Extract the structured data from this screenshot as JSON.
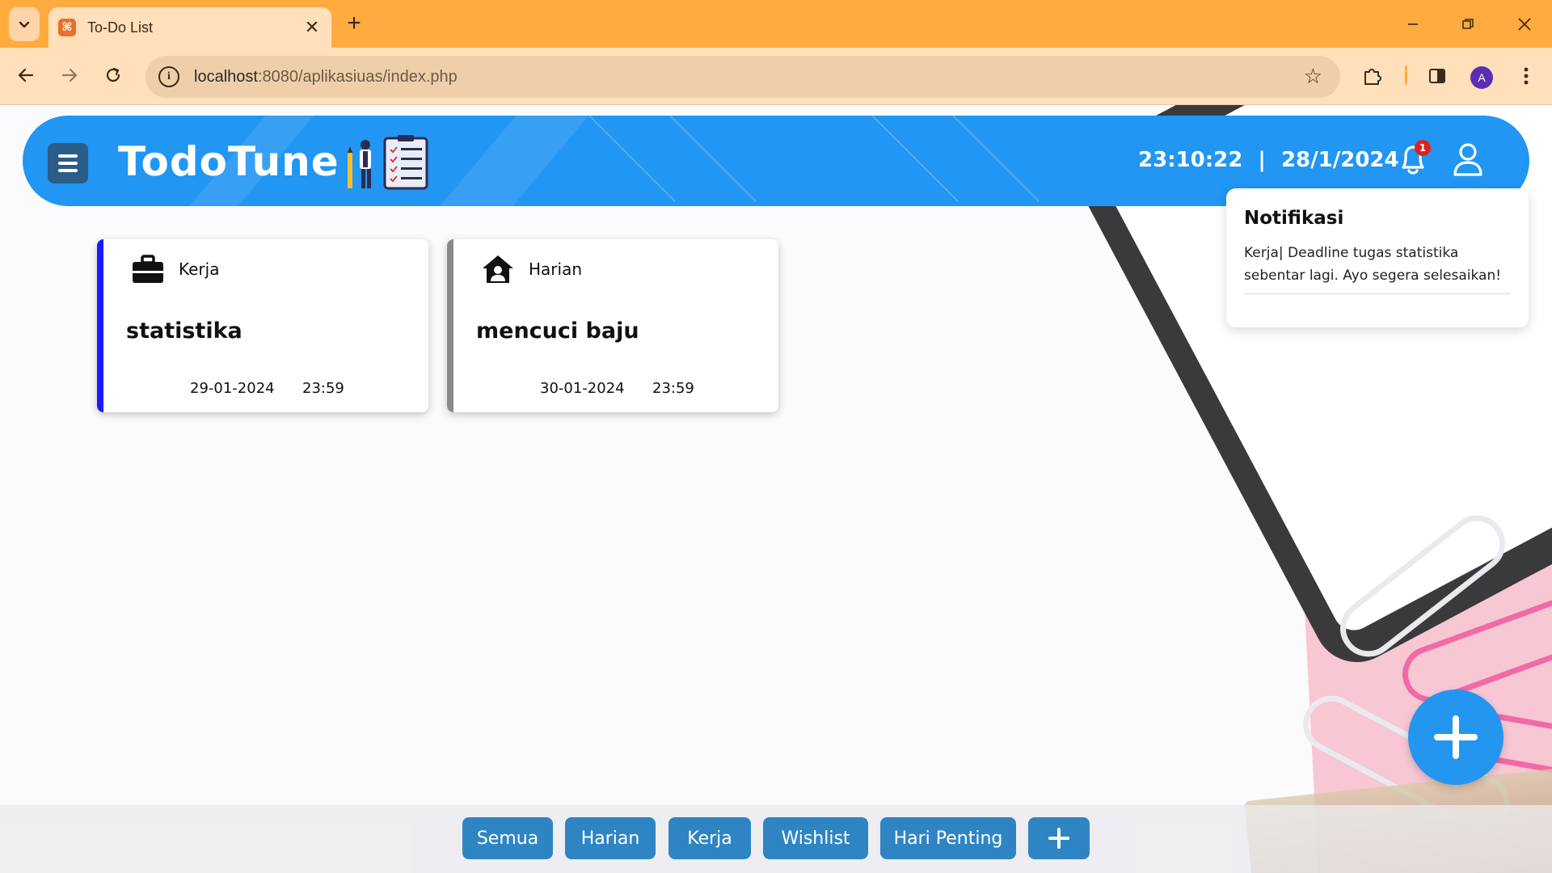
{
  "browser": {
    "tab_title": "To-Do List",
    "url_host": "localhost",
    "url_rest": ":8080/aplikasiuas/index.php",
    "profile_initial": "A",
    "accent_color": "#ffab40"
  },
  "header": {
    "brand": "TodoTune",
    "time": "23:10:22",
    "separator": "|",
    "date": "28/1/2024",
    "notification_count": "1",
    "color": "#2196f3"
  },
  "notification_panel": {
    "title": "Notifikasi",
    "message": "Kerja| Deadline tugas statistika sebentar lagi. Ayo segera selesaikan!"
  },
  "cards": [
    {
      "category": "Kerja",
      "category_icon": "briefcase-icon",
      "title": "statistika",
      "date": "29-01-2024",
      "time": "23:59",
      "accent": "#1a1aff"
    },
    {
      "category": "Harian",
      "category_icon": "house-user-icon",
      "title": "mencuci baju",
      "date": "30-01-2024",
      "time": "23:59",
      "accent": "#8a8a8a"
    }
  ],
  "filters": {
    "all": "Semua",
    "daily": "Harian",
    "work": "Kerja",
    "wishlist": "Wishlist",
    "important": "Hari Penting",
    "add_icon": "plus-icon",
    "color": "#2f85c3"
  },
  "fab": {
    "icon": "plus-icon",
    "color": "#2496f0"
  }
}
